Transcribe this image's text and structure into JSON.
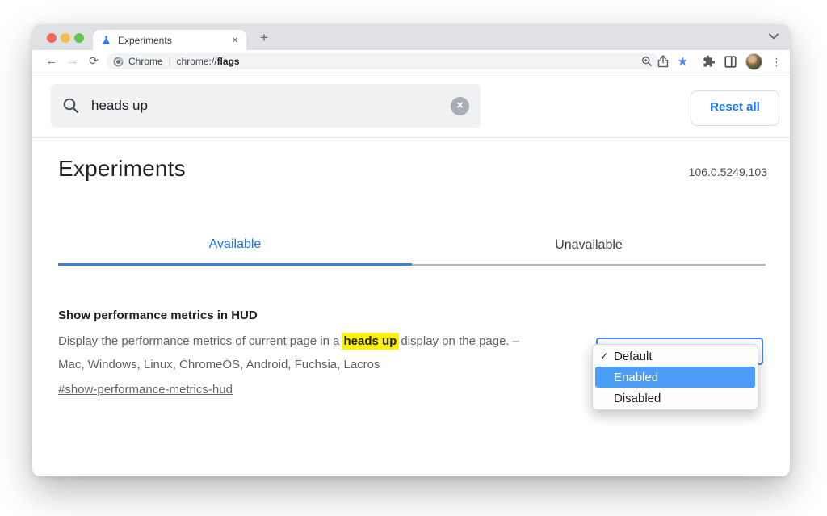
{
  "colors": {
    "accent_blue": "#1A73E8",
    "tab_underline_blue": "#3D7BE5",
    "selection_blue": "#4B9DF8",
    "highlight_yellow": "#FFF100",
    "star_blue": "#4285F4",
    "text_dark": "#202124",
    "text_gray": "#5F6368"
  },
  "icons": {
    "favicon": "flask-icon",
    "search": "magnifier-icon",
    "omnibox_zoom": "magnifier-plus-icon",
    "share": "share-icon",
    "extensions": "puzzle-icon",
    "side_panel": "side-panel-icon",
    "profile": "avatar-photo"
  },
  "tab_strip": {
    "tab_title": "Experiments",
    "close_glyph": "×",
    "new_tab_glyph": "+"
  },
  "toolbar": {
    "back_glyph": "←",
    "forward_glyph": "→",
    "reload_glyph": "⟳",
    "star_glyph": "★",
    "kebab_glyph": "⋮",
    "url_chip": {
      "site_label": "Chrome",
      "separator": "|",
      "scheme": "chrome://",
      "host": "flags"
    }
  },
  "search": {
    "value": "heads up",
    "clear_glyph": "×"
  },
  "reset_button_label": "Reset all",
  "page_header": {
    "title": "Experiments",
    "version": "106.0.5249.103"
  },
  "section_tabs": {
    "available": "Available",
    "unavailable": "Unavailable"
  },
  "flag": {
    "title": "Show performance metrics in HUD",
    "description_before": "Display the performance metrics of current page in a",
    "description_highlight": "heads up",
    "description_after": "display on the page. – Mac, Windows, Linux, ChromeOS, Android, Fuchsia, Lacros",
    "link": "#show-performance-metrics-hud"
  },
  "dropdown": {
    "check_glyph": "✓",
    "selected": "Default",
    "options": [
      {
        "label": "Default",
        "state": "checked"
      },
      {
        "label": "Enabled",
        "state": "highlighted"
      },
      {
        "label": "Disabled",
        "state": "none"
      }
    ]
  }
}
